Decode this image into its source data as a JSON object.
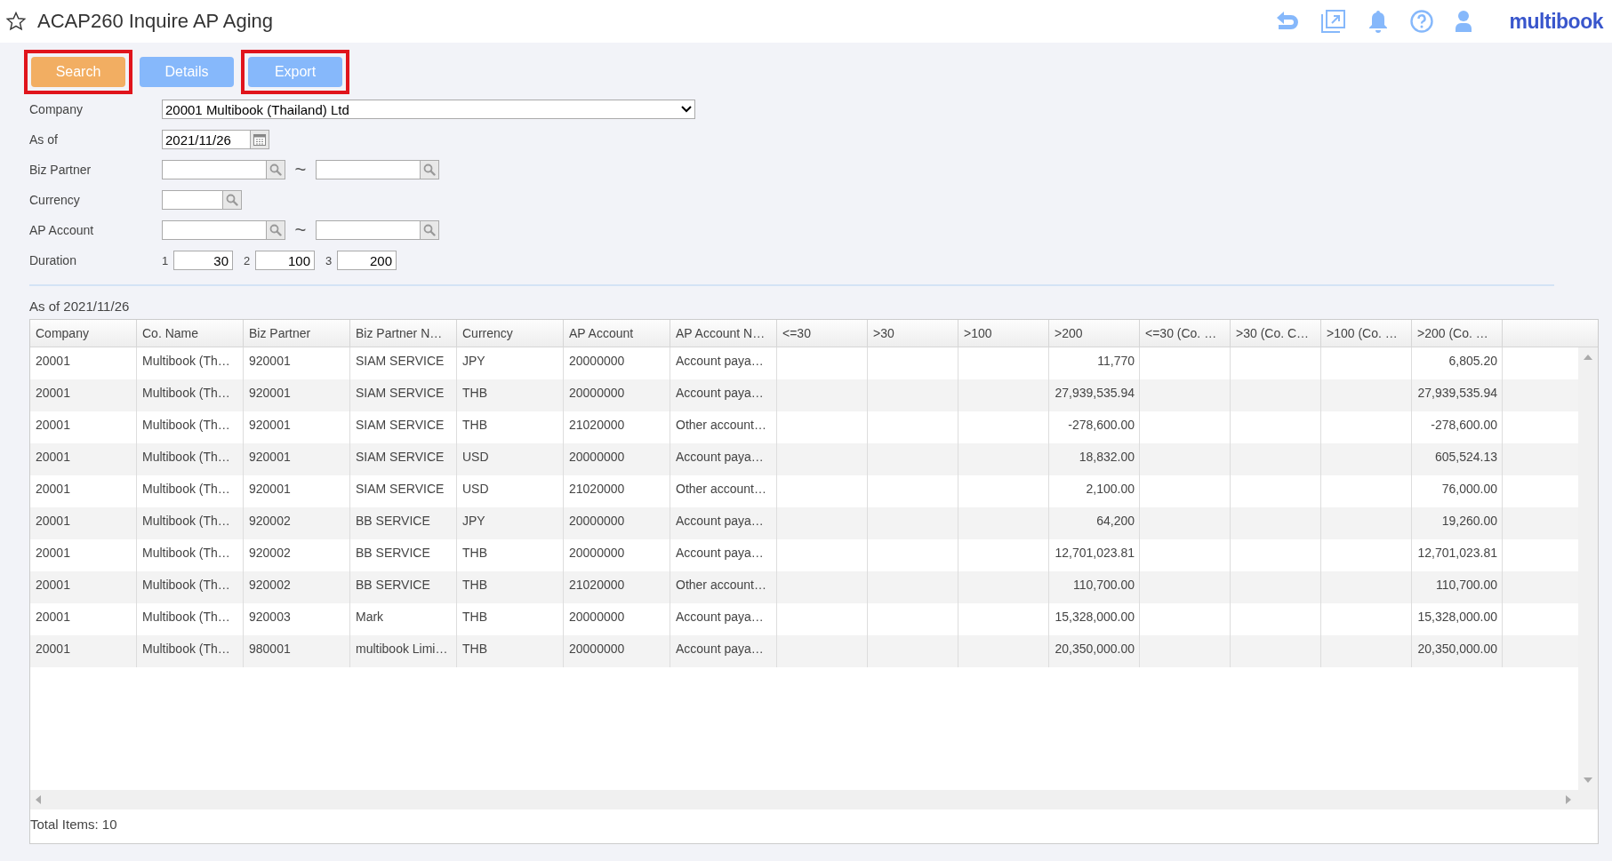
{
  "window": {
    "title": "ACAP260 Inquire AP Aging",
    "favorite": false
  },
  "brand": "multibook",
  "buttons": [
    {
      "label": "Search",
      "kind": "primary",
      "highlighted": true
    },
    {
      "label": "Details",
      "kind": "secondary",
      "highlighted": false
    },
    {
      "label": "Export",
      "kind": "secondary",
      "highlighted": true
    }
  ],
  "form": {
    "company": {
      "label": "Company",
      "value": "20001 Multibook (Thailand) Ltd"
    },
    "as_of": {
      "label": "As of",
      "value": "2021/11/26"
    },
    "biz_partner": {
      "label": "Biz Partner",
      "separator": "~"
    },
    "currency": {
      "label": "Currency"
    },
    "ap_account": {
      "label": "AP Account",
      "separator": "~"
    },
    "duration": {
      "label": "Duration",
      "items": [
        {
          "index": "1",
          "value": "30"
        },
        {
          "index": "2",
          "value": "100"
        },
        {
          "index": "3",
          "value": "200"
        }
      ]
    }
  },
  "result_title": "As of 2021/11/26",
  "table": {
    "columns": [
      "Company",
      "Co. Name",
      "Biz Partner",
      "Biz Partner N…",
      "Currency",
      "AP Account",
      "AP Account N…",
      "<=30",
      ">30",
      ">100",
      ">200",
      "<=30 (Co. …",
      ">30 (Co. C…",
      ">100 (Co. …",
      ">200 (Co. …"
    ],
    "rows": [
      {
        "company": "20001",
        "co_name": "Multibook (Th…",
        "biz_partner": "920001",
        "biz_partner_name": "SIAM SERVICE",
        "currency": "JPY",
        "ap_account": "20000000",
        "ap_account_name": "Account paya…",
        "over_200": "11,770",
        "over_200_co": "6,805.20"
      },
      {
        "company": "20001",
        "co_name": "Multibook (Th…",
        "biz_partner": "920001",
        "biz_partner_name": "SIAM SERVICE",
        "currency": "THB",
        "ap_account": "20000000",
        "ap_account_name": "Account paya…",
        "over_200": "27,939,535.94",
        "over_200_co": "27,939,535.94"
      },
      {
        "company": "20001",
        "co_name": "Multibook (Th…",
        "biz_partner": "920001",
        "biz_partner_name": "SIAM SERVICE",
        "currency": "THB",
        "ap_account": "21020000",
        "ap_account_name": "Other account…",
        "over_200": "-278,600.00",
        "over_200_co": "-278,600.00"
      },
      {
        "company": "20001",
        "co_name": "Multibook (Th…",
        "biz_partner": "920001",
        "biz_partner_name": "SIAM SERVICE",
        "currency": "USD",
        "ap_account": "20000000",
        "ap_account_name": "Account paya…",
        "over_200": "18,832.00",
        "over_200_co": "605,524.13"
      },
      {
        "company": "20001",
        "co_name": "Multibook (Th…",
        "biz_partner": "920001",
        "biz_partner_name": "SIAM SERVICE",
        "currency": "USD",
        "ap_account": "21020000",
        "ap_account_name": "Other account…",
        "over_200": "2,100.00",
        "over_200_co": "76,000.00"
      },
      {
        "company": "20001",
        "co_name": "Multibook (Th…",
        "biz_partner": "920002",
        "biz_partner_name": "BB SERVICE",
        "currency": "JPY",
        "ap_account": "20000000",
        "ap_account_name": "Account paya…",
        "over_200": "64,200",
        "over_200_co": "19,260.00"
      },
      {
        "company": "20001",
        "co_name": "Multibook (Th…",
        "biz_partner": "920002",
        "biz_partner_name": "BB SERVICE",
        "currency": "THB",
        "ap_account": "20000000",
        "ap_account_name": "Account paya…",
        "over_200": "12,701,023.81",
        "over_200_co": "12,701,023.81"
      },
      {
        "company": "20001",
        "co_name": "Multibook (Th…",
        "biz_partner": "920002",
        "biz_partner_name": "BB SERVICE",
        "currency": "THB",
        "ap_account": "21020000",
        "ap_account_name": "Other account…",
        "over_200": "110,700.00",
        "over_200_co": "110,700.00"
      },
      {
        "company": "20001",
        "co_name": "Multibook (Th…",
        "biz_partner": "920003",
        "biz_partner_name": "Mark",
        "currency": "THB",
        "ap_account": "20000000",
        "ap_account_name": "Account paya…",
        "over_200": "15,328,000.00",
        "over_200_co": "15,328,000.00"
      },
      {
        "company": "20001",
        "co_name": "Multibook (Th…",
        "biz_partner": "980001",
        "biz_partner_name": "multibook Limi…",
        "currency": "THB",
        "ap_account": "20000000",
        "ap_account_name": "Account paya…",
        "over_200": "20,350,000.00",
        "over_200_co": "20,350,000.00"
      }
    ]
  },
  "status": "Total Items: 10"
}
